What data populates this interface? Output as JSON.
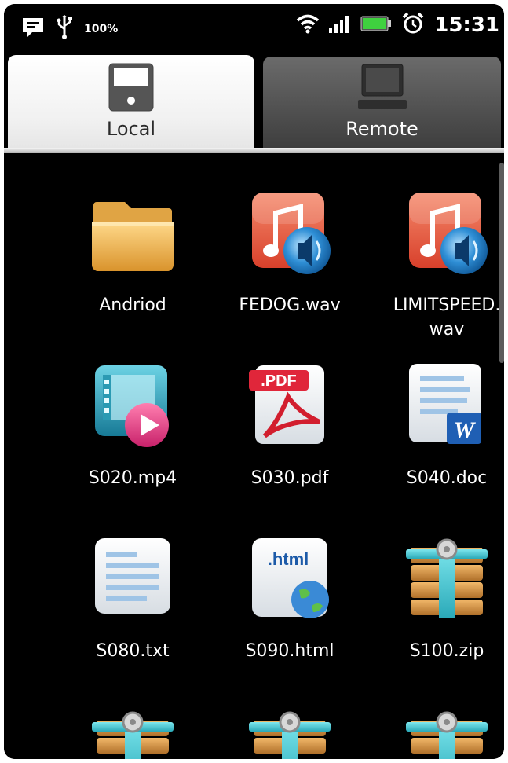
{
  "status_bar": {
    "battery_percent": "100%",
    "time": "15:31"
  },
  "tabs": [
    {
      "label": "Local",
      "selected": true,
      "icon": "device-icon"
    },
    {
      "label": "Remote",
      "selected": false,
      "icon": "computer-icon"
    }
  ],
  "files": [
    {
      "name": "Andriod",
      "type": "folder"
    },
    {
      "name": "FEDOG.wav",
      "type": "audio"
    },
    {
      "name": "LIMITSPEED.\nwav",
      "type": "audio"
    },
    {
      "name": "S020.mp4",
      "type": "video"
    },
    {
      "name": "S030.pdf",
      "type": "pdf"
    },
    {
      "name": "S040.doc",
      "type": "doc"
    },
    {
      "name": "S080.txt",
      "type": "txt"
    },
    {
      "name": "S090.html",
      "type": "html"
    },
    {
      "name": "S100.zip",
      "type": "zip"
    },
    {
      "name": "",
      "type": "zip"
    },
    {
      "name": "",
      "type": "zip"
    },
    {
      "name": "",
      "type": "zip"
    }
  ],
  "icon_text": {
    "pdf": ".PDF",
    "html": ".html",
    "word": "W"
  }
}
